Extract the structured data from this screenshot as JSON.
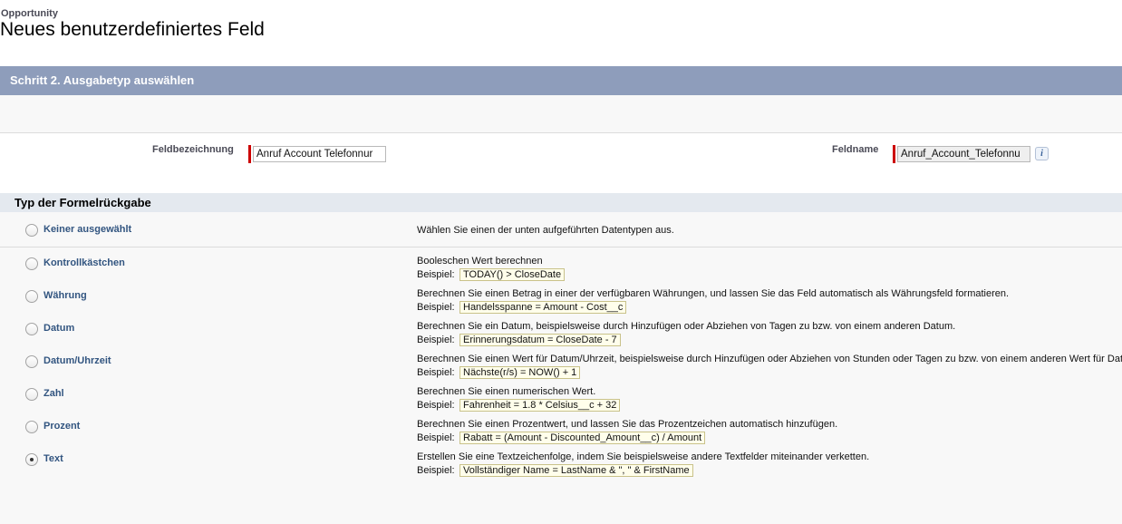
{
  "header": {
    "object_label": "Opportunity",
    "page_title": "Neues benutzerdefiniertes Feld"
  },
  "step": {
    "title": "Schritt 2. Ausgabetyp auswählen"
  },
  "fields": {
    "label_caption": "Feldbezeichnung",
    "label_value": "Anruf Account Telefonnur",
    "name_caption": "Feldname",
    "name_value": "Anruf_Account_Telefonnu",
    "info_glyph": "i"
  },
  "formula_section": {
    "title": "Typ der Formelrückgabe",
    "example_prefix": "Beispiel:",
    "options": [
      {
        "label": "Keiner ausgewählt",
        "description": "Wählen Sie einen der unten aufgeführten Datentypen aus.",
        "example": "",
        "selected": false
      },
      {
        "label": "Kontrollkästchen",
        "description": "Booleschen Wert berechnen",
        "example": "TODAY() > CloseDate",
        "selected": false
      },
      {
        "label": "Währung",
        "description": "Berechnen Sie einen Betrag in einer der verfügbaren Währungen, und lassen Sie das Feld automatisch als Währungsfeld formatieren.",
        "example": "Handelsspanne = Amount - Cost__c",
        "selected": false
      },
      {
        "label": "Datum",
        "description": "Berechnen Sie ein Datum, beispielsweise durch Hinzufügen oder Abziehen von Tagen zu bzw. von einem anderen Datum.",
        "example": "Erinnerungsdatum = CloseDate - 7",
        "selected": false
      },
      {
        "label": "Datum/Uhrzeit",
        "description": "Berechnen Sie einen Wert für Datum/Uhrzeit, beispielsweise durch Hinzufügen oder Abziehen von Stunden oder Tagen zu bzw. von einem anderen Wert für Dat",
        "example": "Nächste(r/s) = NOW() + 1",
        "selected": false
      },
      {
        "label": "Zahl",
        "description": "Berechnen Sie einen numerischen Wert.",
        "example": "Fahrenheit = 1.8 * Celsius__c + 32",
        "selected": false
      },
      {
        "label": "Prozent",
        "description": "Berechnen Sie einen Prozentwert, und lassen Sie das Prozentzeichen automatisch hinzufügen.",
        "example": "Rabatt = (Amount - Discounted_Amount__c) / Amount",
        "selected": false
      },
      {
        "label": "Text",
        "description": "Erstellen Sie eine Textzeichenfolge, indem Sie beispielsweise andere Textfelder miteinander verketten.",
        "example": "Vollständiger Name = LastName & \", \" & FirstName",
        "selected": true
      }
    ]
  }
}
